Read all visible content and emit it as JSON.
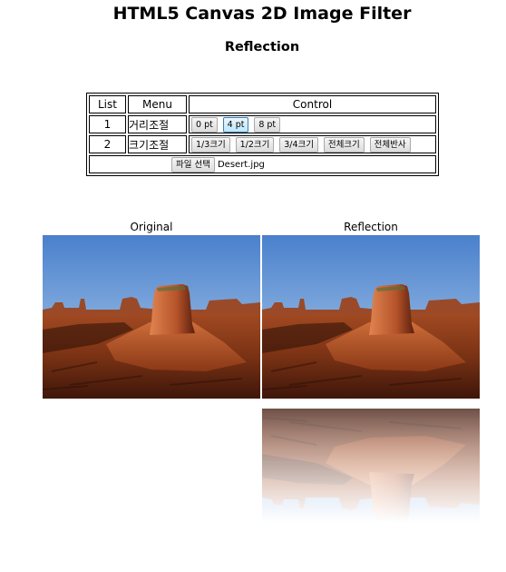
{
  "header": {
    "title": "HTML5 Canvas 2D Image Filter",
    "subtitle": "Reflection"
  },
  "table": {
    "headers": [
      "List",
      "Menu",
      "Control"
    ],
    "rows": [
      {
        "num": "1",
        "menu": "거리조절",
        "buttons": [
          "0 pt",
          "4 pt",
          "8 pt"
        ],
        "active": "4 pt"
      },
      {
        "num": "2",
        "menu": "크기조절",
        "buttons": [
          "1/3크기",
          "1/2크기",
          "3/4크기",
          "전체크기",
          "전체반사"
        ]
      }
    ],
    "file": {
      "button": "파일 선택",
      "name": "Desert.jpg"
    }
  },
  "panels": {
    "original_label": "Original",
    "reflection_label": "Reflection"
  },
  "image": {
    "icon": "desert-mesa-photo",
    "sky_top": "#4a80cc",
    "sky_bottom": "#b6d3ee",
    "rock": "#b5532a",
    "ground": "#6a2810"
  }
}
